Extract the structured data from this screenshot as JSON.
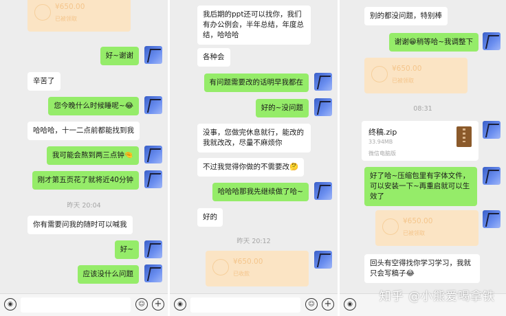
{
  "panel1": {
    "transfer_top": {
      "amount": "¥650.00",
      "status": "已被领取"
    },
    "m1": "好~谢谢",
    "m2": "辛苦了",
    "m3": "您今晚什么时候睡呢~😂",
    "m4": "哈哈哈，十一二点前都能找到我",
    "m5": "我可能会熬到两三点钟🤏",
    "m6": "刚才第五页花了就将近40分钟",
    "time": "昨天 20:04",
    "m7": "你有需要问我的随时可以喊我",
    "m8": "好~",
    "m9": "应该没什么问题"
  },
  "panel2": {
    "m1": "我后期的ppt还可以找你，我们有办公例会，半年总结，年度总结，哈哈哈",
    "m2": "各种会",
    "m3": "有问题需要改的话明早我都在",
    "m4": "好的~没问题",
    "m5": "没事，您做完休息就行，能改的我就改改，尽量不麻烦你",
    "m6": "不过我觉得你做的不需要改🤔",
    "m7": "哈哈哈那我先继续做了哈~",
    "m8": "好的",
    "time": "昨天 20:12",
    "transfer": {
      "amount": "¥650.00",
      "status": "已收款"
    }
  },
  "panel3": {
    "m1": "别的都没问题，特别棒",
    "m2": "谢谢😁稍等哈~我调整下",
    "transfer1": {
      "amount": "¥650.00",
      "status": "已被领取"
    },
    "time": "08:31",
    "file": {
      "name": "终稿.zip",
      "size": "33.94MB",
      "source": "微信电脑版"
    },
    "m3": "好了哈~压缩包里有字体文件，可以安装一下~再重启就可以生效了",
    "transfer2": {
      "amount": "¥650.00",
      "status": "已被领取"
    },
    "m4": "回头有空得找你学习学习，我就只会写稿子😂"
  },
  "inputbar": {
    "voice_icon": "voice-icon",
    "emoji_icon": "emoji-icon",
    "plus_icon": "plus-icon"
  },
  "watermark": "知乎 @小熊爱喝拿铁"
}
